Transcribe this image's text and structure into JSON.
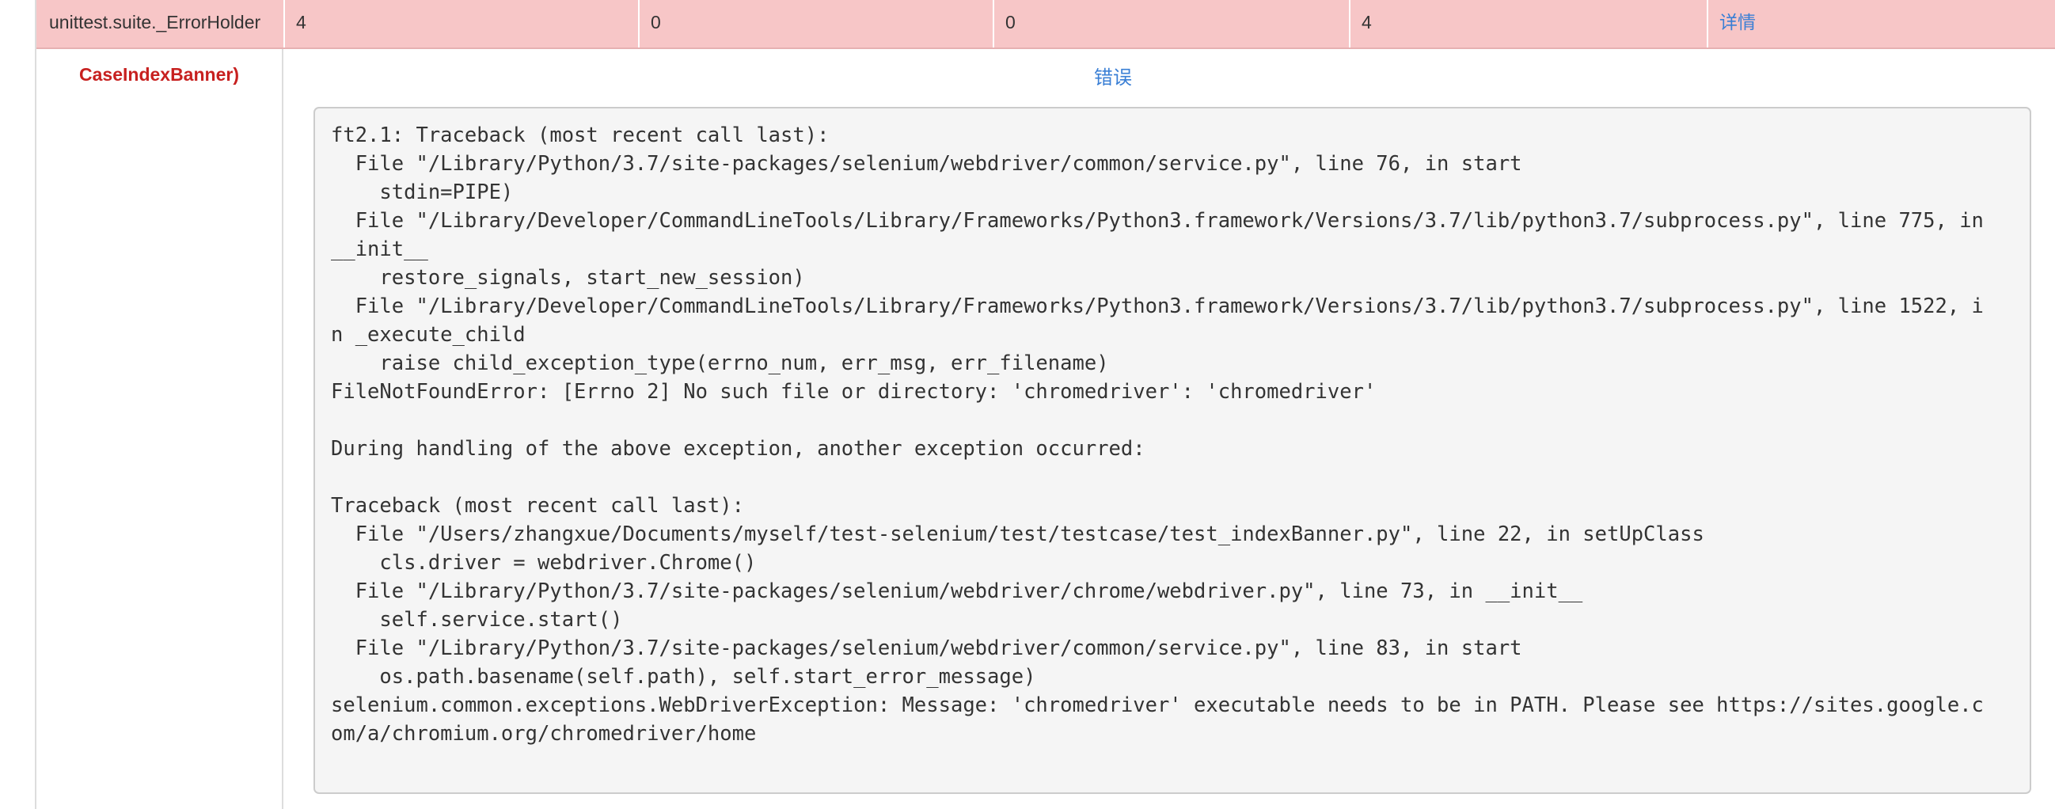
{
  "summary_row": {
    "name": "unittest.suite._ErrorHolder",
    "count": "4",
    "pass": "0",
    "fail": "0",
    "error": "4",
    "detail_link": "详情"
  },
  "case": {
    "name": "CaseIndexBanner)",
    "status_label": "错误",
    "traceback": "ft2.1: Traceback (most recent call last):\n  File \"/Library/Python/3.7/site-packages/selenium/webdriver/common/service.py\", line 76, in start\n    stdin=PIPE)\n  File \"/Library/Developer/CommandLineTools/Library/Frameworks/Python3.framework/Versions/3.7/lib/python3.7/subprocess.py\", line 775, in\n__init__\n    restore_signals, start_new_session)\n  File \"/Library/Developer/CommandLineTools/Library/Frameworks/Python3.framework/Versions/3.7/lib/python3.7/subprocess.py\", line 1522, i\nn _execute_child\n    raise child_exception_type(errno_num, err_msg, err_filename)\nFileNotFoundError: [Errno 2] No such file or directory: 'chromedriver': 'chromedriver'\n\nDuring handling of the above exception, another exception occurred:\n\nTraceback (most recent call last):\n  File \"/Users/zhangxue/Documents/myself/test-selenium/test/testcase/test_indexBanner.py\", line 22, in setUpClass\n    cls.driver = webdriver.Chrome()\n  File \"/Library/Python/3.7/site-packages/selenium/webdriver/chrome/webdriver.py\", line 73, in __init__\n    self.service.start()\n  File \"/Library/Python/3.7/site-packages/selenium/webdriver/common/service.py\", line 83, in start\n    os.path.basename(self.path), self.start_error_message)\nselenium.common.exceptions.WebDriverException: Message: 'chromedriver' executable needs to be in PATH. Please see https://sites.google.c\nom/a/chromium.org/chromedriver/home"
  },
  "colors": {
    "error_row_bg": "#f7c6c7",
    "case_name_red": "#c7201f",
    "link_blue": "#3a7fd5",
    "trace_bg": "#f5f5f5"
  }
}
